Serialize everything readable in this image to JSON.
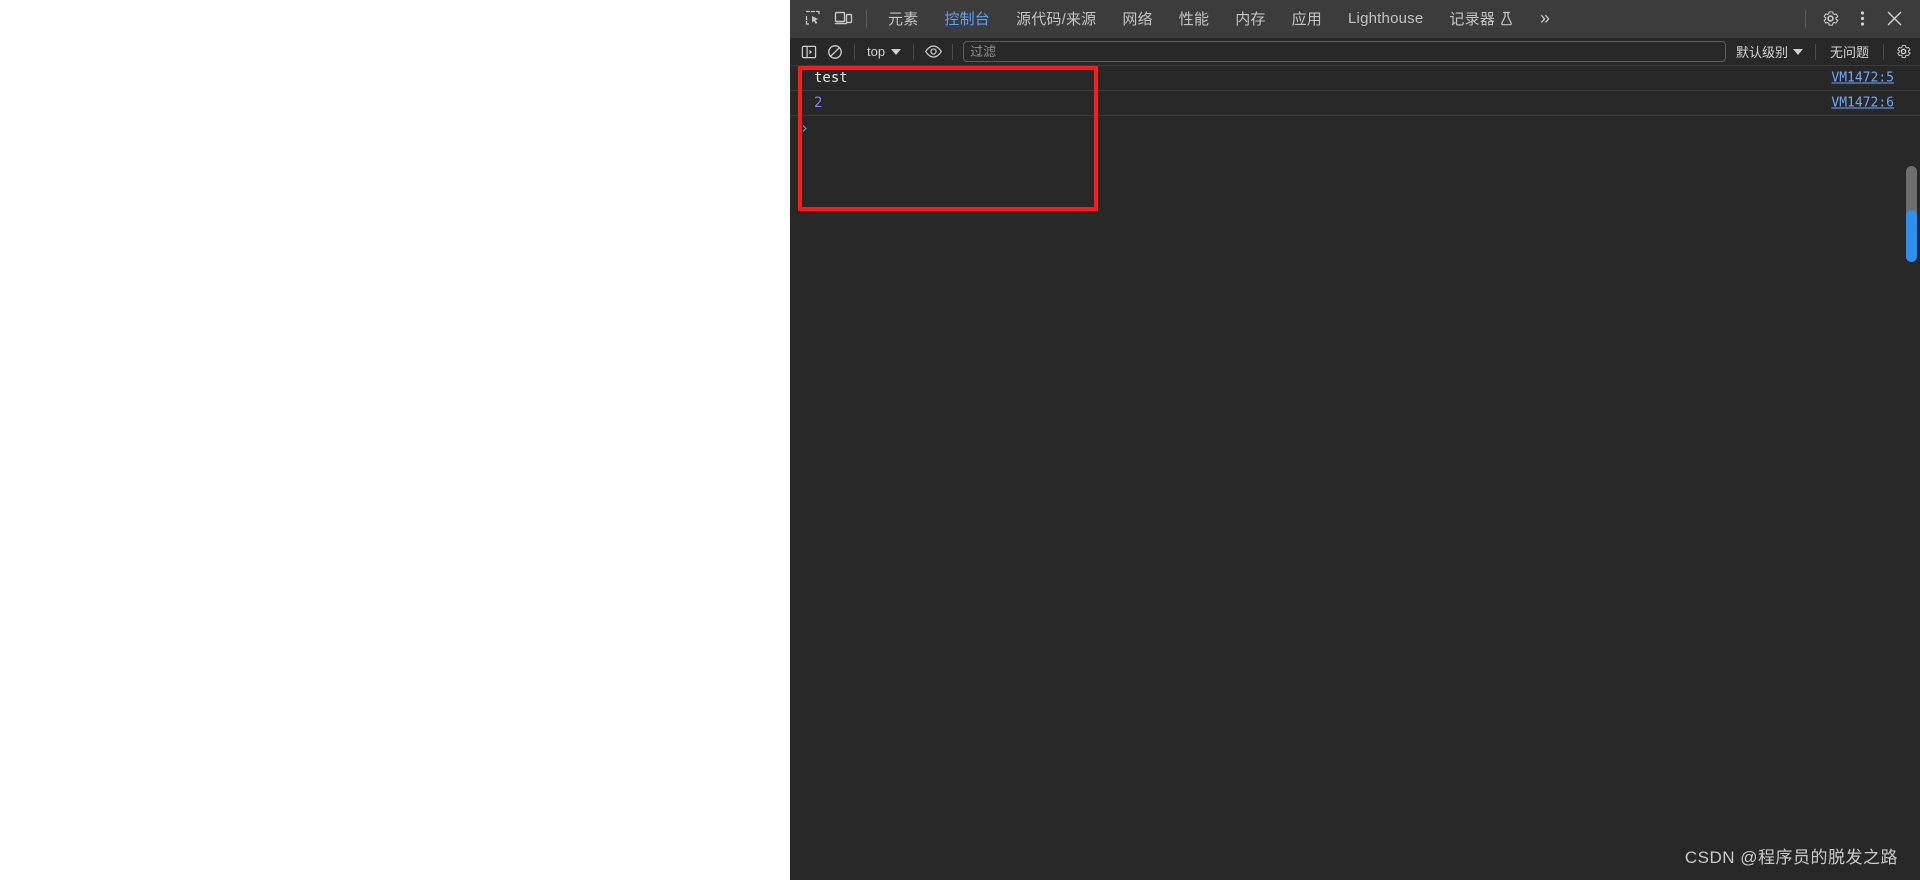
{
  "page": {
    "viewport_background": "#ffffff"
  },
  "devtools": {
    "background": "#282828",
    "toolbar_background": "#3c3c3c",
    "accent_color": "#5ba2f7",
    "left_buttons": [
      {
        "name": "inspect-element-icon",
        "title": "检查元素"
      },
      {
        "name": "device-toolbar-icon",
        "title": "切换设备工具栏"
      }
    ],
    "tabs": [
      {
        "label": "元素",
        "active": false
      },
      {
        "label": "控制台",
        "active": true
      },
      {
        "label": "源代码/来源",
        "active": false
      },
      {
        "label": "网络",
        "active": false
      },
      {
        "label": "性能",
        "active": false
      },
      {
        "label": "内存",
        "active": false
      },
      {
        "label": "应用",
        "active": false
      },
      {
        "label": "Lighthouse",
        "active": false
      },
      {
        "label": "记录器",
        "active": false,
        "icon": "flask-icon"
      }
    ],
    "overflow_label": "»",
    "right_buttons": [
      {
        "name": "settings-gear-icon"
      },
      {
        "name": "more-options-kebab-icon"
      },
      {
        "name": "close-icon"
      }
    ]
  },
  "console_toolbar": {
    "sidebar_toggle": "console-sidebar-icon",
    "clear_console": "clear-console-icon",
    "context": {
      "label": "top",
      "caret": "chevron-down-icon"
    },
    "eye_button": "live-expression-eye-icon",
    "filter": {
      "placeholder": "过滤",
      "value": ""
    },
    "level": {
      "label": "默认级别",
      "caret": "chevron-down-icon"
    },
    "issues_label": "无问题",
    "settings_gear": "console-settings-gear-icon"
  },
  "console": {
    "messages": [
      {
        "text": "test",
        "kind": "string",
        "source": "VM1472:5"
      },
      {
        "text": "2",
        "kind": "number",
        "source": "VM1472:6"
      }
    ],
    "prompt_chevron": "›",
    "prompt_value": ""
  },
  "annotation": {
    "name": "red-highlight-box",
    "color": "#fb1b1b"
  },
  "scrollbar": {
    "track_color": "#6e6e6e",
    "thumb_color": "#2f8fef"
  },
  "watermark": {
    "text": "CSDN @程序员的脱发之路"
  }
}
